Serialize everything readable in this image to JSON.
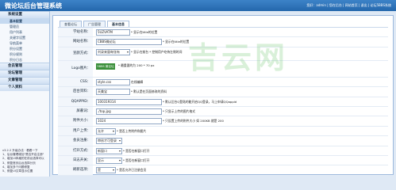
{
  "header": {
    "title": "微论坛后台管理系统",
    "links": "您好：admin | 您在后台 | 网站首页 | 退出 | 论坛5BBS系统"
  },
  "sidebar": {
    "groups": [
      {
        "title": "系统设置",
        "items": [
          "基本配置",
          "管理员",
          "用户列表",
          "关键字设置",
          "导航菜单",
          "积分设置",
          "积分规则",
          "积分日志"
        ]
      },
      {
        "title": "会员管理"
      },
      {
        "title": "论坛管理"
      },
      {
        "title": "文章管理"
      },
      {
        "title": "个人资料"
      }
    ],
    "notes": [
      "v3.2.2 升级办法 · 看看一下",
      "1、后台管理增加\"是否开启注册\"",
      "2、增加UI风格的在前台选择可以",
      "3、修复首页后台选择分页",
      "4、增加多个问题修复",
      "5、修复UI文章显示位置"
    ]
  },
  "tabs": [
    "查看论坛",
    "广告管理",
    "基本信息"
  ],
  "form": [
    {
      "label": "学站名称：",
      "value": "5UZVATM",
      "note": "* 显示在title的位置"
    },
    {
      "label": "网站名称：",
      "value": "CBBS微论坛",
      "note": "* 显示在title的位置"
    },
    {
      "label": "宣颜方式：",
      "value": "刘录来量每张有",
      "note": "* 显示在前台\n* 控制用户吃待左侧时间"
    },
    {
      "label": "Logo图片：",
      "value": "5BBS 微论坛",
      "note": "* 最重要的为 200 * 70 px"
    },
    {
      "label": "CSS：",
      "value": "style.css",
      "note": "在线编辑"
    },
    {
      "label": "后台资料：",
      "value": "天美宝",
      "note": "* 默认是在页面修改的资料"
    },
    {
      "label": "QQAPPID：",
      "value": "100319314",
      "note": "* 默认后台Q登陆的能开启QQ登录，马上申请QQappid"
    },
    {
      "label": "屏蔽词：",
      "value": "./top.jpg",
      "note": "* 只显示上传的图片格式"
    },
    {
      "label": "附件大小：",
      "value": "1024",
      "note": "* 只设置上传的附件大小  如  200KB 就是 200"
    },
    {
      "label": "用户上传：",
      "value": "允许",
      "note": "* 是否上传附件和图片"
    },
    {
      "label": "会员注册：",
      "value": "审核才可登录",
      "note": ""
    },
    {
      "label": "打开方式：",
      "value": "新窗口",
      "note": "* 是否在新窗口打开"
    },
    {
      "label": "日志开关：",
      "value": "显示",
      "note": "* 是否在新窗口打开"
    },
    {
      "label": "刷新选项：",
      "value": "是",
      "note": "* 是否允许已注册会员"
    }
  ],
  "watermark": "吉云网"
}
